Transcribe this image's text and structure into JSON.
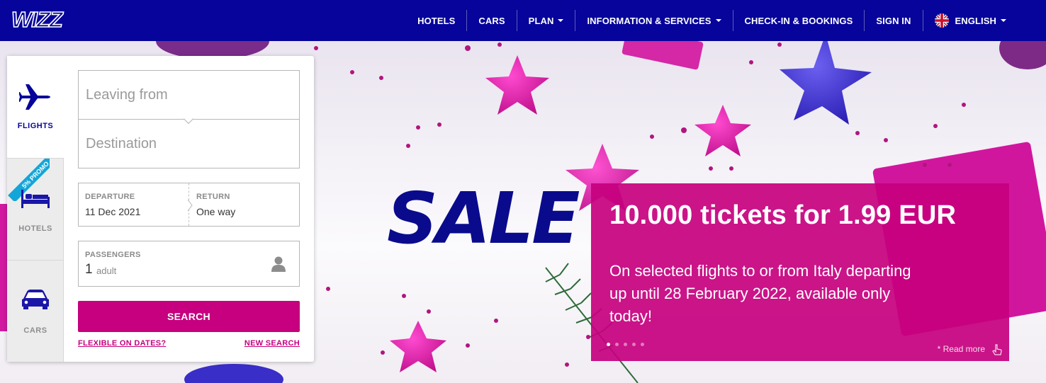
{
  "brand": {
    "logo_text": "WIZZ",
    "primary_color": "#06049a",
    "accent_color": "#c6007e",
    "promo_ribbon_color": "#14a6d9"
  },
  "nav": {
    "items": [
      {
        "label": "HOTELS"
      },
      {
        "label": "CARS"
      },
      {
        "label": "PLAN"
      },
      {
        "label": "INFORMATION & SERVICES"
      },
      {
        "label": "CHECK-IN & BOOKINGS"
      },
      {
        "label": "SIGN IN"
      },
      {
        "label": "ENGLISH"
      }
    ]
  },
  "search_panel": {
    "tabs": [
      {
        "label": "FLIGHTS",
        "icon": "plane-icon",
        "active": true
      },
      {
        "label": "HOTELS",
        "icon": "bed-icon",
        "active": false,
        "ribbon": "5% PROMO"
      },
      {
        "label": "CARS",
        "icon": "car-icon",
        "active": false
      }
    ],
    "origin_placeholder": "Leaving from",
    "destination_placeholder": "Destination",
    "departure_label": "DEPARTURE",
    "departure_value": "11 Dec 2021",
    "return_label": "RETURN",
    "return_value": "One way",
    "passengers_label": "PASSENGERS",
    "passengers_count": "1",
    "passengers_unit": "adult",
    "search_button": "SEARCH",
    "flexible_link": "FLEXIBLE ON DATES?",
    "new_search_link": "NEW SEARCH"
  },
  "hero": {
    "background_word": "SALE",
    "promo_title": "10.000 tickets for 1.99 EUR",
    "promo_text": "On selected flights to or from Italy departing up until 28 February 2022, available only today!",
    "read_more": "* Read more",
    "slides": 5,
    "active_slide": 1
  }
}
